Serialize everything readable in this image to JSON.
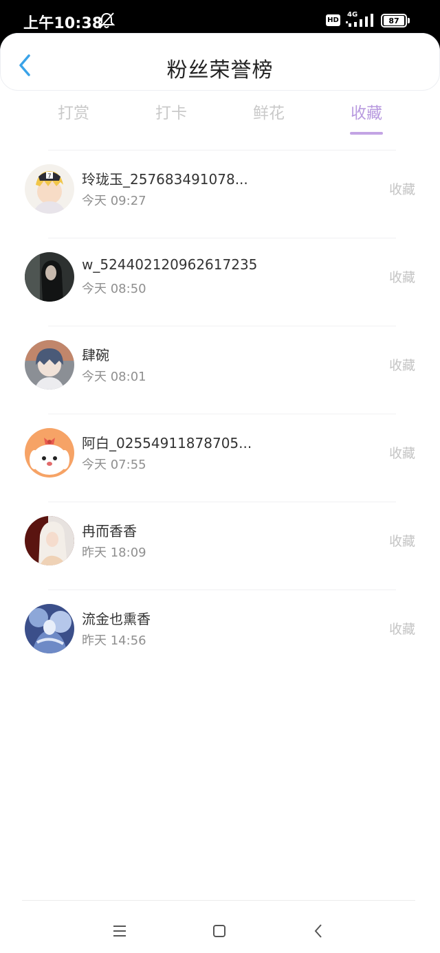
{
  "status_bar": {
    "time": "上午10:38",
    "hd": "HD",
    "network": "4G",
    "battery": "87"
  },
  "nav": {
    "title": "粉丝荣誉榜"
  },
  "tabs": [
    {
      "label": "打赏",
      "active": false
    },
    {
      "label": "打卡",
      "active": false
    },
    {
      "label": "鲜花",
      "active": false
    },
    {
      "label": "收藏",
      "active": true
    }
  ],
  "list": [
    {
      "name": "玲珑玉_257683491078...",
      "time": "今天 09:27",
      "action": "收藏"
    },
    {
      "name": "w_524402120962617235",
      "time": "今天 08:50",
      "action": "收藏"
    },
    {
      "name": "肆碗",
      "time": "今天 08:01",
      "action": "收藏"
    },
    {
      "name": "阿白_02554911878705...",
      "time": "今天 07:55",
      "action": "收藏"
    },
    {
      "name": "冉而香香",
      "time": "昨天 18:09",
      "action": "收藏"
    },
    {
      "name": "流金也熏香",
      "time": "昨天 14:56",
      "action": "收藏"
    }
  ],
  "icons": {
    "back": "chevron-left-icon",
    "mute": "mute-icon",
    "signal": "signal-icon",
    "menu": "menu-icon",
    "home": "home-icon",
    "sys_back": "back-icon"
  },
  "colors": {
    "accent": "#b89adf",
    "back_arrow": "#3aa3e8"
  }
}
